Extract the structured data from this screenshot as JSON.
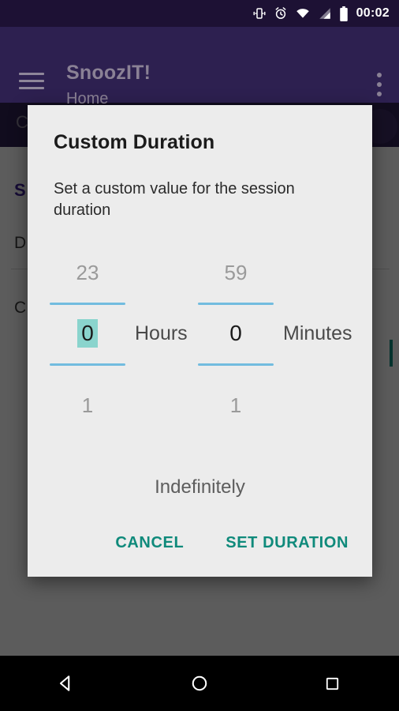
{
  "status_bar": {
    "time": "00:02",
    "icons": [
      "vibrate-icon",
      "alarm-icon",
      "wifi-icon",
      "signal-icon",
      "battery-icon"
    ]
  },
  "app_bar": {
    "menu_icon": "hamburger-menu-icon",
    "title": "SnoozIT!",
    "subtitle": "Home",
    "overflow_icon": "overflow-menu-icon"
  },
  "background": {
    "chip_text": "C",
    "heading": "S",
    "line1": "D",
    "line2": "C"
  },
  "dialog": {
    "title": "Custom Duration",
    "message": "Set a custom value for the session duration",
    "pickers": [
      {
        "name": "hours",
        "label": "Hours",
        "value_above": "23",
        "value": "0",
        "value_below": "1",
        "selected": true
      },
      {
        "name": "minutes",
        "label": "Minutes",
        "value_above": "59",
        "value": "0",
        "value_below": "1",
        "selected": false
      }
    ],
    "indefinitely_label": "Indefinitely",
    "cancel_label": "CANCEL",
    "confirm_label": "SET DURATION"
  },
  "nav_bar": {
    "back": "back-triangle-icon",
    "home": "home-circle-icon",
    "recents": "recents-square-icon"
  },
  "colors": {
    "status_bar": "#1d1134",
    "app_bar": "#2d2050",
    "dialog_bg": "#ececec",
    "accent_teal": "#0f8a7b",
    "picker_rule": "#72bcdf",
    "selection": "#8ad4cd"
  }
}
